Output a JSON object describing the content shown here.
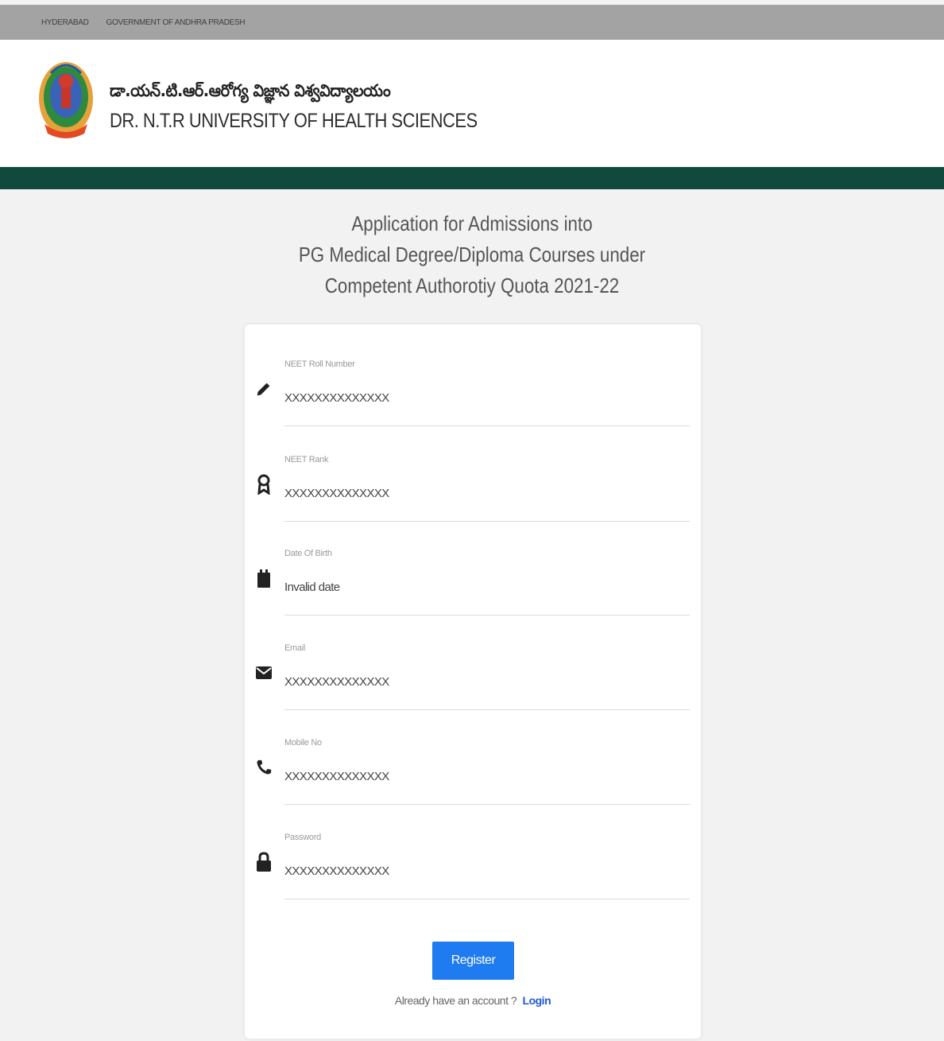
{
  "topbar": {
    "links": [
      "HYDERABAD",
      "GOVERNMENT OF ANDHRA PRADESH"
    ]
  },
  "header": {
    "title_telugu": "డా.యన్.టి.ఆర్.ఆరోగ్య విజ్ఞాన విశ్వవిద్యాలయం",
    "title_english": "DR. N.T.R UNIVERSITY OF HEALTH SCIENCES",
    "logo_icon": "university-emblem-icon"
  },
  "colors": {
    "topbar": "#a3a3a3",
    "brand_green": "#0f4a3c",
    "primary_button": "#1f7bf0",
    "link": "#1f5bd0"
  },
  "page": {
    "heading_line1": "Application for Admissions into",
    "heading_line2": "PG Medical Degree/Diploma Courses under",
    "heading_line3": "Competent Authorotiy Quota 2021-22"
  },
  "form": {
    "fields": [
      {
        "label": "NEET Roll Number",
        "value": "XXXXXXXXXXXXXX",
        "icon": "pencil-icon"
      },
      {
        "label": "NEET Rank",
        "value": "XXXXXXXXXXXXXX",
        "icon": "award-icon"
      },
      {
        "label": "Date Of Birth",
        "value": "Invalid date",
        "icon": "calendar-icon"
      },
      {
        "label": "Email",
        "value": "XXXXXXXXXXXXXX",
        "icon": "envelope-icon"
      },
      {
        "label": "Mobile No",
        "value": "XXXXXXXXXXXXXX",
        "icon": "phone-icon"
      },
      {
        "label": "Password",
        "value": "XXXXXXXXXXXXXX",
        "icon": "lock-icon"
      }
    ],
    "register_label": "Register",
    "login_prompt": "Already have an account ?",
    "login_label": "Login"
  }
}
